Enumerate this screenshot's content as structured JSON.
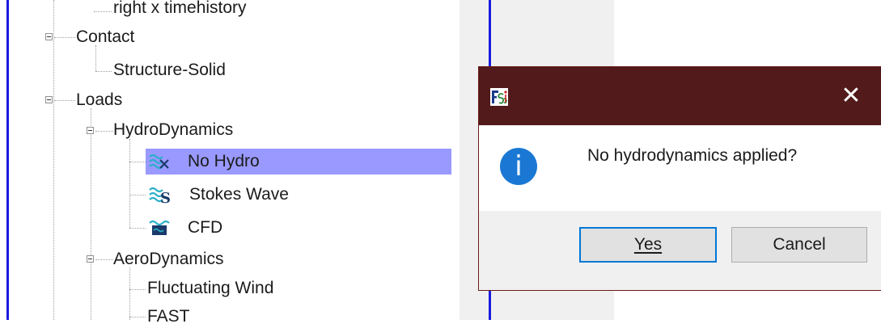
{
  "tree": {
    "top_partial": "right x timehistory",
    "contact": {
      "label": "Contact",
      "children": [
        "Structure-Solid"
      ]
    },
    "loads": {
      "label": "Loads",
      "hydrodynamics": {
        "label": "HydroDynamics",
        "children": [
          {
            "label": "No Hydro",
            "icon": "no-hydro-icon",
            "selected": true
          },
          {
            "label": "Stokes Wave",
            "icon": "stokes-wave-icon",
            "selected": false
          },
          {
            "label": "CFD",
            "icon": "cfd-icon",
            "selected": false
          }
        ]
      },
      "aerodynamics": {
        "label": "AeroDynamics",
        "children": [
          "Fluctuating Wind",
          "FAST"
        ]
      }
    }
  },
  "dialog": {
    "message": "No hydrodynamics applied?",
    "close_glyph": "✕",
    "info_glyph": "i",
    "yes_label": "Yes",
    "cancel_label": "Cancel",
    "titlebar_color": "#521a1a",
    "info_color": "#1a78d4"
  },
  "colors": {
    "selection": "#9999ff",
    "border_accent": "#1a1ae0"
  }
}
